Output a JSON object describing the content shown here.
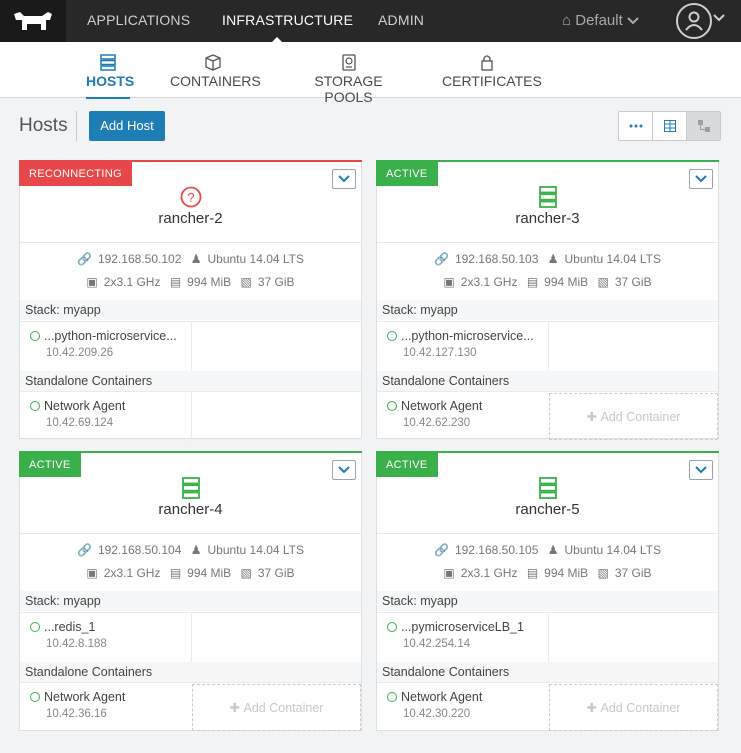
{
  "topnav": {
    "items": [
      "APPLICATIONS",
      "INFRASTRUCTURE",
      "ADMIN"
    ],
    "active": "INFRASTRUCTURE",
    "environment": "Default"
  },
  "subnav": {
    "tabs": [
      "HOSTS",
      "CONTAINERS",
      "STORAGE POOLS",
      "CERTIFICATES"
    ],
    "active": "HOSTS"
  },
  "header": {
    "title": "Hosts",
    "add_button": "Add Host"
  },
  "colors": {
    "accent": "#1f7db6",
    "active": "#3ab04a",
    "reconnecting": "#e8474a"
  },
  "hosts": [
    {
      "state": "RECONNECTING",
      "name": "rancher-2",
      "ip": "192.168.50.102",
      "os": "Ubuntu 14.04 LTS",
      "cpu": "2x3.1 GHz",
      "memory": "994 MiB",
      "storage": "37 GiB",
      "stack_label": "Stack: myapp",
      "stack_container": {
        "name": "...python-microservice...",
        "ip": "10.42.209.26"
      },
      "standalone_label": "Standalone Containers",
      "standalone_container": {
        "name": "Network Agent",
        "ip": "10.42.69.124"
      },
      "add_container": ""
    },
    {
      "state": "ACTIVE",
      "name": "rancher-3",
      "ip": "192.168.50.103",
      "os": "Ubuntu 14.04 LTS",
      "cpu": "2x3.1 GHz",
      "memory": "994 MiB",
      "storage": "37 GiB",
      "stack_label": "Stack: myapp",
      "stack_container": {
        "name": "...python-microservice...",
        "ip": "10.42.127.130"
      },
      "standalone_label": "Standalone Containers",
      "standalone_container": {
        "name": "Network Agent",
        "ip": "10.42.62.230"
      },
      "add_container": "Add Container"
    },
    {
      "state": "ACTIVE",
      "name": "rancher-4",
      "ip": "192.168.50.104",
      "os": "Ubuntu 14.04 LTS",
      "cpu": "2x3.1 GHz",
      "memory": "994 MiB",
      "storage": "37 GiB",
      "stack_label": "Stack: myapp",
      "stack_container": {
        "name": "...redis_1",
        "ip": "10.42.8.188"
      },
      "standalone_label": "Standalone Containers",
      "standalone_container": {
        "name": "Network Agent",
        "ip": "10.42.36.16"
      },
      "add_container": "Add Container"
    },
    {
      "state": "ACTIVE",
      "name": "rancher-5",
      "ip": "192.168.50.105",
      "os": "Ubuntu 14.04 LTS",
      "cpu": "2x3.1 GHz",
      "memory": "994 MiB",
      "storage": "37 GiB",
      "stack_label": "Stack: myapp",
      "stack_container": {
        "name": "...pymicroserviceLB_1",
        "ip": "10.42.254.14"
      },
      "standalone_label": "Standalone Containers",
      "standalone_container": {
        "name": "Network Agent",
        "ip": "10.42.30.220"
      },
      "add_container": "Add Container"
    }
  ]
}
